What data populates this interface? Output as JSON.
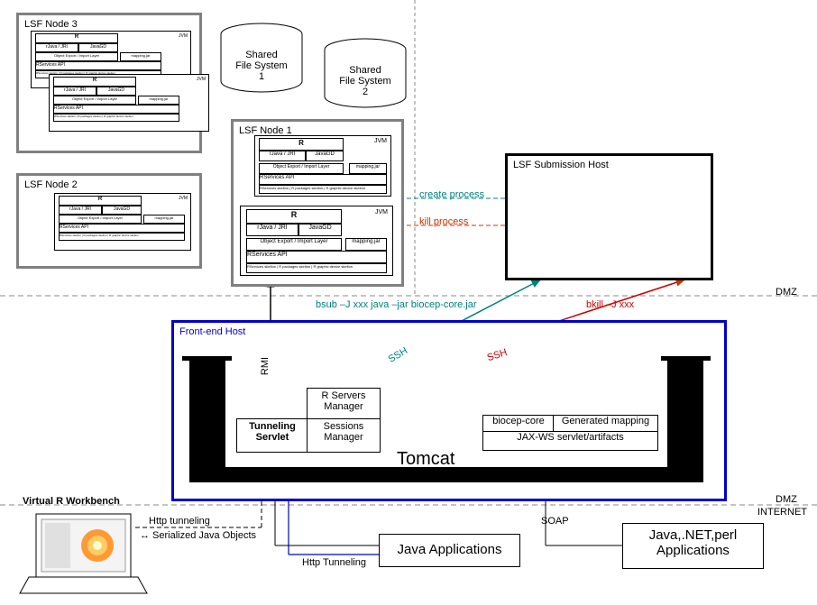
{
  "nodes": {
    "lsf3": "LSF Node 3",
    "lsf2": "LSF Node 2",
    "lsf1": "LSF Node 1",
    "sfs1": "Shared\nFile System 1",
    "sfs2": "Shared\nFile System 2",
    "submission": "LSF Submission Host"
  },
  "inner": {
    "r": "R",
    "jvm": "JVM",
    "rjava": "rJava / JRI",
    "javagd": "JavaGD",
    "objlayer": "Object Export / Import Layer",
    "mapping": "mapping.jar",
    "rservices": "RServices API",
    "skeletons": "RServices skelton | R packages skelton | R graphic device skelton"
  },
  "frontend": {
    "host": "Front-end Host",
    "rsm": "R Servers Manager",
    "tun": "Tunneling Servlet",
    "sess": "Sessions Manager",
    "biocep": "biocep-core",
    "genmap": "Generated mapping",
    "jaxws": "JAX-WS servlet/artifacts",
    "tomcat": "Tomcat"
  },
  "edges": {
    "create": "create process",
    "kill": "kill process",
    "bsub": "bsub –J xxx java –jar biocep-core.jar",
    "bkill": "bkill –J xxx",
    "rmi": "RMI",
    "ssh": "SSH",
    "http": "Http tunneling",
    "ser": "↔ Serialized Java Objects",
    "http2": "Http Tunneling",
    "soap": "SOAP"
  },
  "zones": {
    "dmz": "DMZ",
    "internet": "INTERNET"
  },
  "clients": {
    "vrw": "Virtual R Workbench",
    "java": "Java Applications",
    "multi": "Java,.NET,perl Applications"
  }
}
